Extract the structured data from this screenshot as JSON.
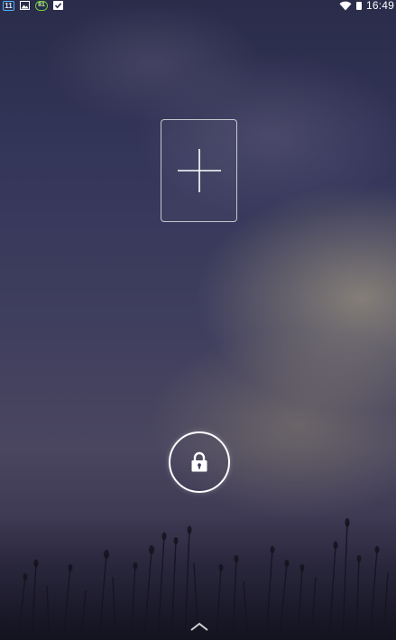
{
  "status_bar": {
    "calendar_badge": "11",
    "battery_badge": "81",
    "time": "16:49",
    "icons": [
      "calendar-icon",
      "image-icon",
      "battery-badge-icon",
      "check-icon",
      "wifi-icon",
      "battery-icon"
    ]
  },
  "lockscreen": {
    "add_widget_icon": "plus-icon",
    "lock_icon": "lock-icon",
    "swipe_icon": "chevron-up-icon"
  },
  "colors": {
    "accent_blue": "#4fb3ff",
    "accent_green": "#6ccc3a",
    "foreground": "#ffffff"
  }
}
